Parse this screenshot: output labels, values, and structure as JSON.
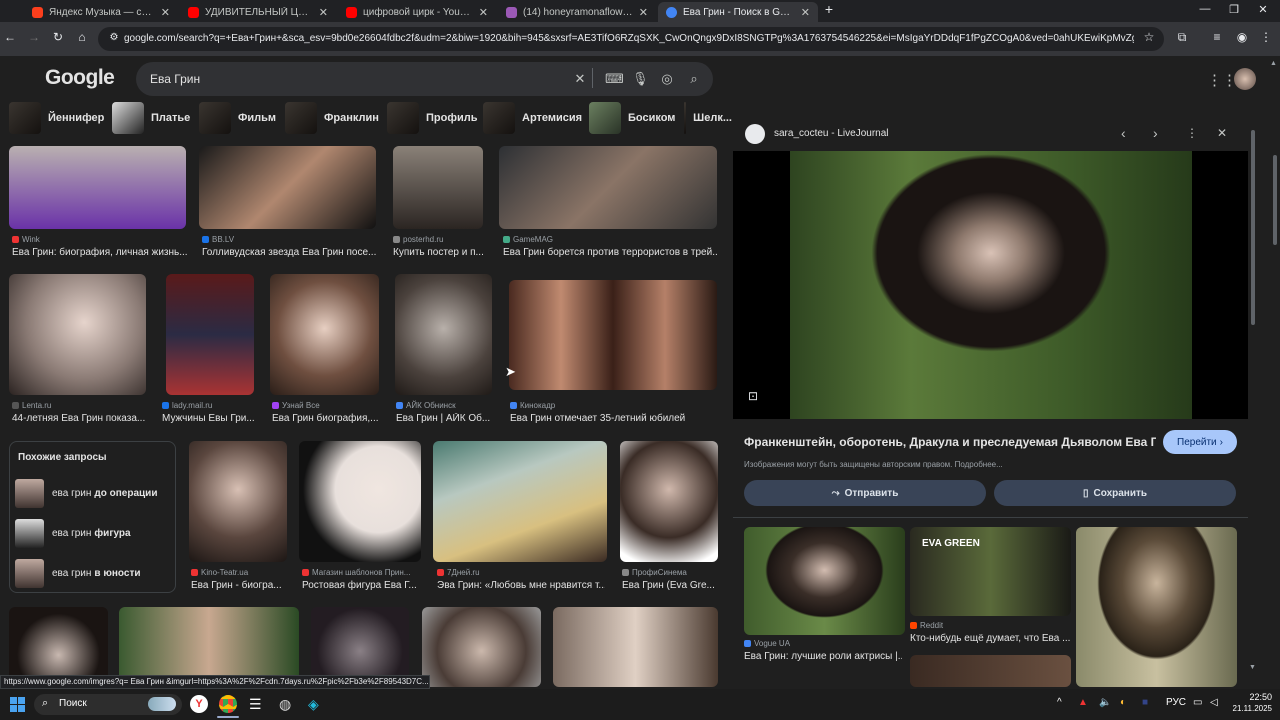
{
  "browser": {
    "tabs": [
      {
        "title": "Яндекс Музыка — собираем м",
        "favicon_color": "#fc3f1d",
        "active": false
      },
      {
        "title": "УДИВИТЕЛЬНЫЙ ЦИФРОВОЙ",
        "favicon_color": "#ff0000",
        "active": false
      },
      {
        "title": "цифровой цирк - YouTube",
        "favicon_color": "#ff0000",
        "active": false
      },
      {
        "title": "(14) honeyramonaflowers",
        "favicon_color": "#9b59b6",
        "active": false
      },
      {
        "title": "Ева Грин - Поиск в Google",
        "favicon_color": "#4285f4",
        "active": true
      }
    ],
    "new_tab_label": "+",
    "url": "google.com/search?q=+Ева+Грин+&sca_esv=9bd0e26604fdbc2f&udm=2&biw=1920&bih=945&sxsrf=AE3TifO6RZqSXK_CwOnQngx9DxI8SNGTPg%3A1763754546225&ei=MsIgaYrDDdqF1fPgZCOgA0&ved=0ahUKEwiKpMvZgYSRAxXaQIUIH..."
  },
  "google": {
    "logo": "Google",
    "query": "Ева Грин",
    "chips": [
      "Йеннифер",
      "Платье",
      "Фильм",
      "Франклин",
      "Профиль",
      "Артемисия",
      "Босиком",
      "Шелк..."
    ]
  },
  "results": {
    "row1": [
      {
        "source": "Wink",
        "caption": "Ева Грин: биография, личная жизнь...",
        "color": "#e33"
      },
      {
        "source": "BB.LV",
        "caption": "Голливудская звезда Ева Грин посе...",
        "color": "#1a73e8"
      },
      {
        "source": "posterhd.ru",
        "caption": "Купить постер и п...",
        "color": "#888"
      },
      {
        "source": "GameMAG",
        "caption": "Ева Грин борется против террористов в трей...",
        "color": "#4a8"
      }
    ],
    "row2": [
      {
        "source": "Lenta.ru",
        "caption": "44-летняя Ева Грин показа...",
        "color": "#555"
      },
      {
        "source": "lady.mail.ru",
        "caption": "Мужчины Евы Гри...",
        "color": "#1a73e8"
      },
      {
        "source": "Узнай Все",
        "caption": "Ева Грин биография,...",
        "color": "#a142f4"
      },
      {
        "source": "АЙК Обнинск",
        "caption": "Ева Грин | АЙК Об...",
        "color": "#4285f4"
      },
      {
        "source": "Кинокадр",
        "caption": "Ева Грин отмечает 35-летний юбилей",
        "color": "#4285f4"
      }
    ],
    "row3": [
      {
        "source": "Kino-Teatr.ua",
        "caption": "Ева Грин - биогра...",
        "color": "#e33"
      },
      {
        "source": "Магазин шаблонов Прин...",
        "caption": "Ростовая фигура Ева Г...",
        "color": "#e33"
      },
      {
        "source": "7Дней.ru",
        "caption": "Эва Грин: «Любовь мне нравится т...",
        "color": "#e33"
      },
      {
        "source": "ПрофиСинема",
        "caption": "Ева Грин (Eva Gre...",
        "color": "#888"
      }
    ]
  },
  "related": {
    "title": "Похожие запросы",
    "items": [
      {
        "prefix": "ева грин ",
        "bold": "до операции"
      },
      {
        "prefix": "ева грин ",
        "bold": "фигура"
      },
      {
        "prefix": "ева грин ",
        "bold": "в юности"
      }
    ]
  },
  "panel": {
    "source": "sara_cocteu - LiveJournal",
    "title": "Франкенштейн, оборотень, Дракула и преследуемая Дьяволом Ева Грин",
    "visit": "Перейти",
    "copyright": "Изображения могут быть защищены авторским правом. Подробнее...",
    "share": "Отправить",
    "save": "Сохранить",
    "similar": [
      {
        "source": "Vogue UA",
        "caption": "Ева Грин: лучшие роли актрисы |...",
        "color": "#4285f4"
      },
      {
        "source": "Reddit",
        "caption": "Кто-нибудь ещё думает, что Ева ...",
        "color": "#ff4500"
      }
    ],
    "similar_overlay": "EVA GREEN"
  },
  "status_url": "https://www.google.com/imgres?q= Ева Грин &imgurl=https%3A%2F%2Fcdn.7days.ru%2Fpic%2Fb3e%2F89543D7C...",
  "taskbar": {
    "search_label": "Поиск",
    "lang": "РУС",
    "time": "22:50",
    "date": "21.11.2025"
  }
}
